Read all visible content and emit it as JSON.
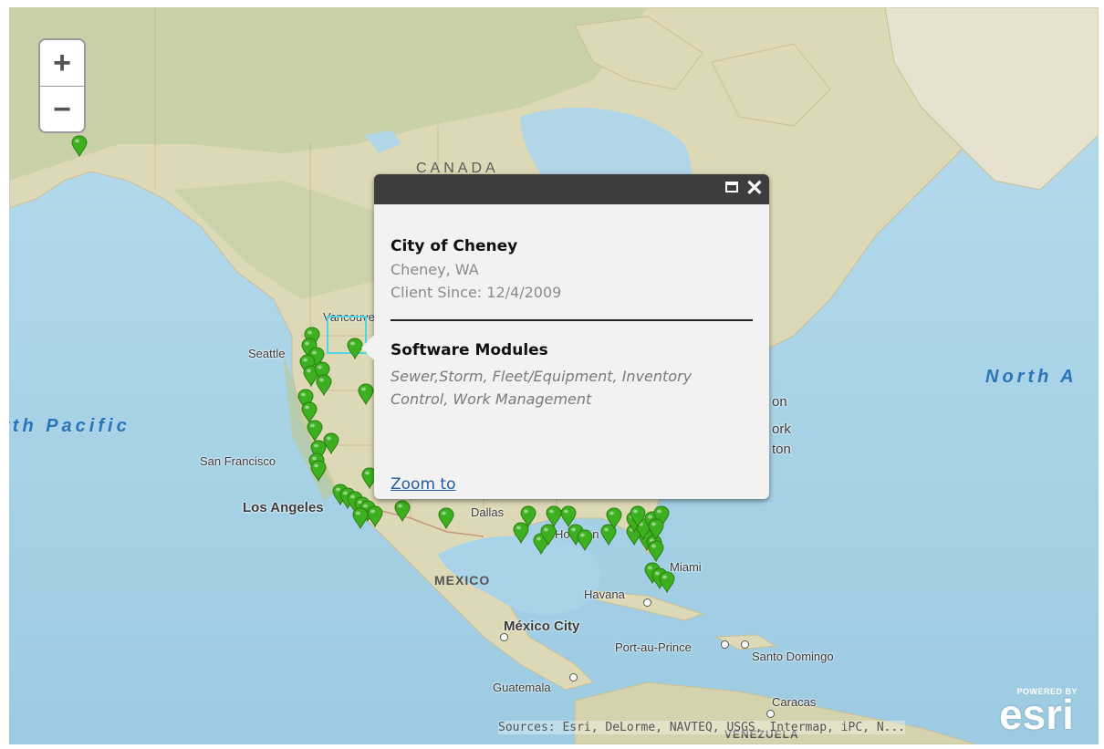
{
  "map": {
    "controls": {
      "zoom_in": "+",
      "zoom_out": "−"
    },
    "labels": {
      "canada": "CANADA",
      "mexico": "MEXICO",
      "north_pacific": "rth Pacific",
      "north_atlantic": "North A",
      "vancouver": "Vancouver",
      "seattle": "Seattle",
      "san_francisco": "San Francisco",
      "los_angeles": "Los Angeles",
      "dallas": "Dallas",
      "houston": "Houston",
      "miami": "Miami",
      "havana": "Havana",
      "mexico_city": "México City",
      "port_au_prince": "Port-au-Prince",
      "santo_domingo": "Santo Domingo",
      "guatemala": "Guatemala",
      "caracas": "Caracas",
      "venezuela": "VENEZUELA",
      "on_fragment": "on",
      "york_fragment": "ork",
      "ton_fragment": "ton"
    },
    "marker_color": "#3cb01e",
    "selection_color": "#4fd6e0"
  },
  "popup": {
    "title": "City of Cheney",
    "location": "Cheney, WA",
    "client_since": "Client Since: 12/4/2009",
    "modules_heading": "Software Modules",
    "modules": "Sewer,Storm, Fleet/Equipment, Inventory Control, Work Management",
    "zoom_to": "Zoom to",
    "maximize_icon": "maximize-icon",
    "close_icon": "close-icon"
  },
  "attribution": "Sources: Esri, DeLorme, NAVTEQ, USGS, Intermap, iPC, N...",
  "logo": {
    "powered_by": "POWERED BY",
    "name": "esri"
  }
}
